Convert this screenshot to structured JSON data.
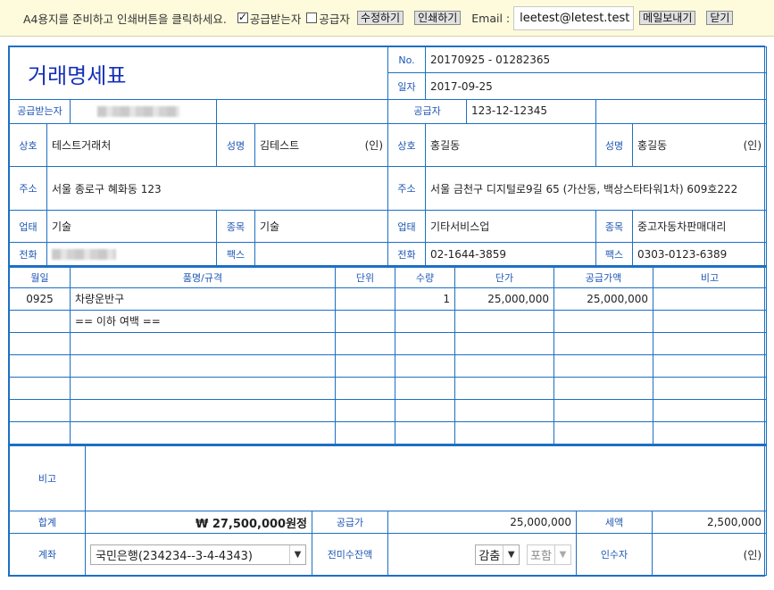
{
  "toolbar": {
    "instruction": "A4용지를 준비하고 인쇄버튼을 클릭하세요.",
    "checkbox_receiver": "공급받는자",
    "checkbox_supplier": "공급자",
    "edit_button": "수정하기",
    "print_button": "인쇄하기",
    "email_label": "Email :",
    "email_value": "leetest@letest.test",
    "send_mail_button": "메일보내기",
    "close_button": "닫기"
  },
  "header": {
    "title": "거래명세표",
    "no_label": "No.",
    "no_value": "20170925 - 01282365",
    "date_label": "일자",
    "date_value": "2017-09-25",
    "receiver_label": "공급받는자",
    "supplier_label": "공급자",
    "supplier_reg_no": "123-12-12345"
  },
  "labels": {
    "company": "상호",
    "ceo": "성명",
    "seal": "(인)",
    "address": "주소",
    "business_type": "업태",
    "business_item": "종목",
    "phone": "전화",
    "fax": "팩스"
  },
  "receiver": {
    "company": "테스트거래처",
    "ceo": "김테스트",
    "address": "서울 종로구 혜화동 123",
    "business_type": "기술",
    "business_item": "기술",
    "fax": ""
  },
  "supplier": {
    "company": "홍길동",
    "ceo": "홍길동",
    "address": "서울 금천구 디지털로9길 65 (가산동, 백상스타타워1차) 609호222",
    "business_type": "기타서비스업",
    "business_item": "중고자동차판매대리",
    "phone": "02-1644-3859",
    "fax": "0303-0123-6389"
  },
  "items": {
    "columns": [
      "월일",
      "품명/규격",
      "단위",
      "수량",
      "단가",
      "공급가액",
      "비고"
    ],
    "rows": [
      {
        "date": "0925",
        "name": "차량운반구",
        "unit": "",
        "qty": "1",
        "price": "25,000,000",
        "amount": "25,000,000",
        "note": ""
      },
      {
        "date": "",
        "name": "== 이하 여백 ==",
        "unit": "",
        "qty": "",
        "price": "",
        "amount": "",
        "note": ""
      },
      {
        "date": "",
        "name": "",
        "unit": "",
        "qty": "",
        "price": "",
        "amount": "",
        "note": ""
      },
      {
        "date": "",
        "name": "",
        "unit": "",
        "qty": "",
        "price": "",
        "amount": "",
        "note": ""
      },
      {
        "date": "",
        "name": "",
        "unit": "",
        "qty": "",
        "price": "",
        "amount": "",
        "note": ""
      },
      {
        "date": "",
        "name": "",
        "unit": "",
        "qty": "",
        "price": "",
        "amount": "",
        "note": ""
      },
      {
        "date": "",
        "name": "",
        "unit": "",
        "qty": "",
        "price": "",
        "amount": "",
        "note": ""
      }
    ]
  },
  "footer": {
    "remarks_label": "비고",
    "remarks_value": "",
    "total_label": "합계",
    "total_value": "₩ 27,500,000원정",
    "supply_label": "공급가",
    "supply_value": "25,000,000",
    "tax_label": "세액",
    "tax_value": "2,500,000",
    "account_label": "계좌",
    "account_value": "국민은행(234234--3-4-4343)",
    "unpaid_label": "전미수잔액",
    "deduct_select": "감춤",
    "include_select": "포함",
    "recipient_label": "인수자",
    "recipient_seal": "(인)"
  }
}
